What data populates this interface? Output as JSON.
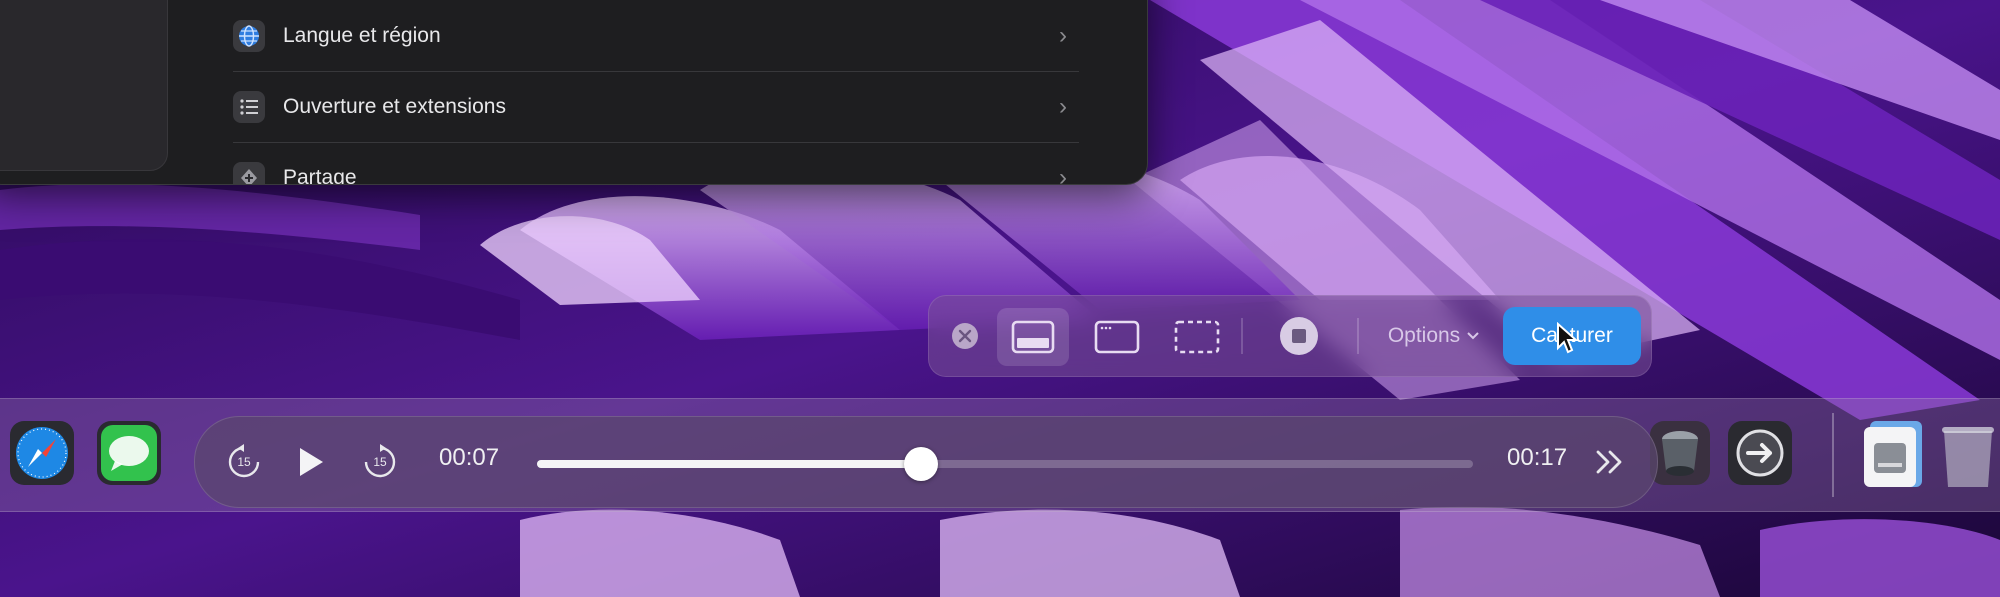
{
  "settings": {
    "items": [
      {
        "label": "Langue et région",
        "icon": "globe-icon"
      },
      {
        "label": "Ouverture et extensions",
        "icon": "list-icon"
      },
      {
        "label": "Partage",
        "icon": "share-icon"
      }
    ]
  },
  "capture_toolbar": {
    "close_icon": "close-icon",
    "modes": [
      "capture-entire-screen-icon",
      "capture-window-icon",
      "capture-selection-icon"
    ],
    "stop_icon": "stop-record-icon",
    "options_label": "Options",
    "capture_label": "Capturer"
  },
  "player": {
    "elapsed": "00:07",
    "total": "00:17",
    "progress": 0.41,
    "skip_back_label": "15",
    "skip_forward_label": "15"
  },
  "dock": {
    "apps": [
      "safari-icon",
      "messages-icon",
      "dock-item-icon",
      "arrow-app-icon",
      "disk-utility-icon",
      "trash-icon"
    ]
  },
  "colors": {
    "accent": "#2f8ee8",
    "wallpaper": "#5a1fa0"
  }
}
